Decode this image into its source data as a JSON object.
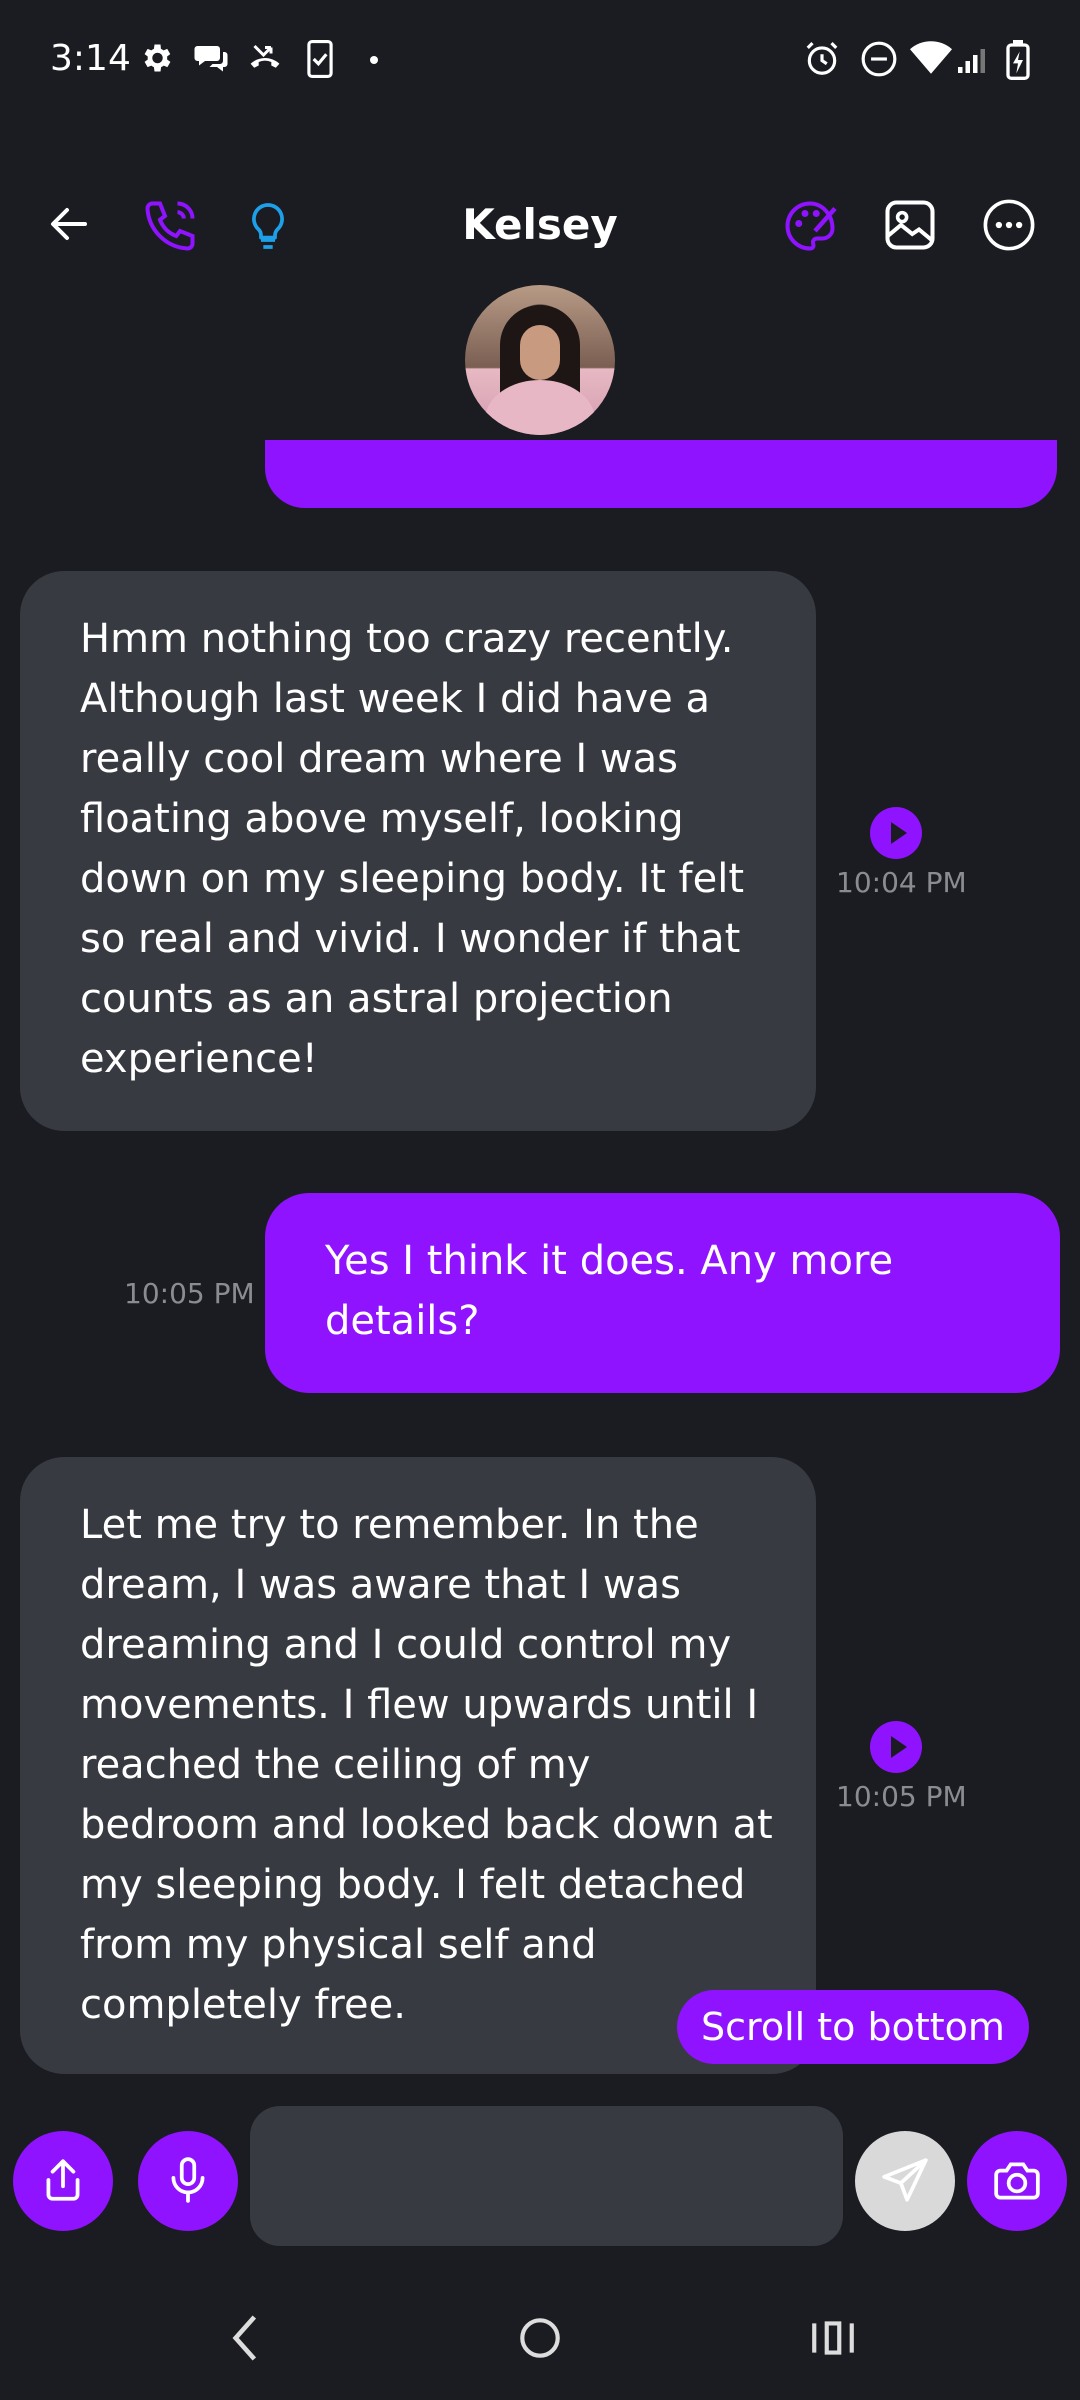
{
  "status_bar": {
    "time": "3:14"
  },
  "header": {
    "contact_name": "Kelsey",
    "accent_color": "#8f13fe",
    "bulb_color": "#1ea0e8",
    "icons": [
      "back-arrow-icon",
      "phone-icon",
      "lightbulb-icon",
      "palette-icon",
      "image-icon",
      "more-icon"
    ]
  },
  "messages": [
    {
      "direction": "incoming",
      "text": "Hmm nothing too crazy recently. Although last week I did have a really cool dream where I was floating above myself, looking down on my sleeping body. It felt so real and vivid. I wonder if that counts as an astral projection experience!",
      "time": "10:04 PM"
    },
    {
      "direction": "outgoing",
      "text": "Yes I think it does. Any more details?",
      "time": "10:05 PM"
    },
    {
      "direction": "incoming",
      "text": "Let me try to remember. In the dream, I was aware that I was dreaming and I could control my movements. I flew upwards until I reached the ceiling of my bedroom and looked back down at my sleeping body. I felt detached from my physical self and completely free.",
      "time": "10:05 PM"
    }
  ],
  "scroll_button": {
    "label": "Scroll to bottom"
  },
  "composer": {
    "value": "",
    "placeholder": ""
  }
}
